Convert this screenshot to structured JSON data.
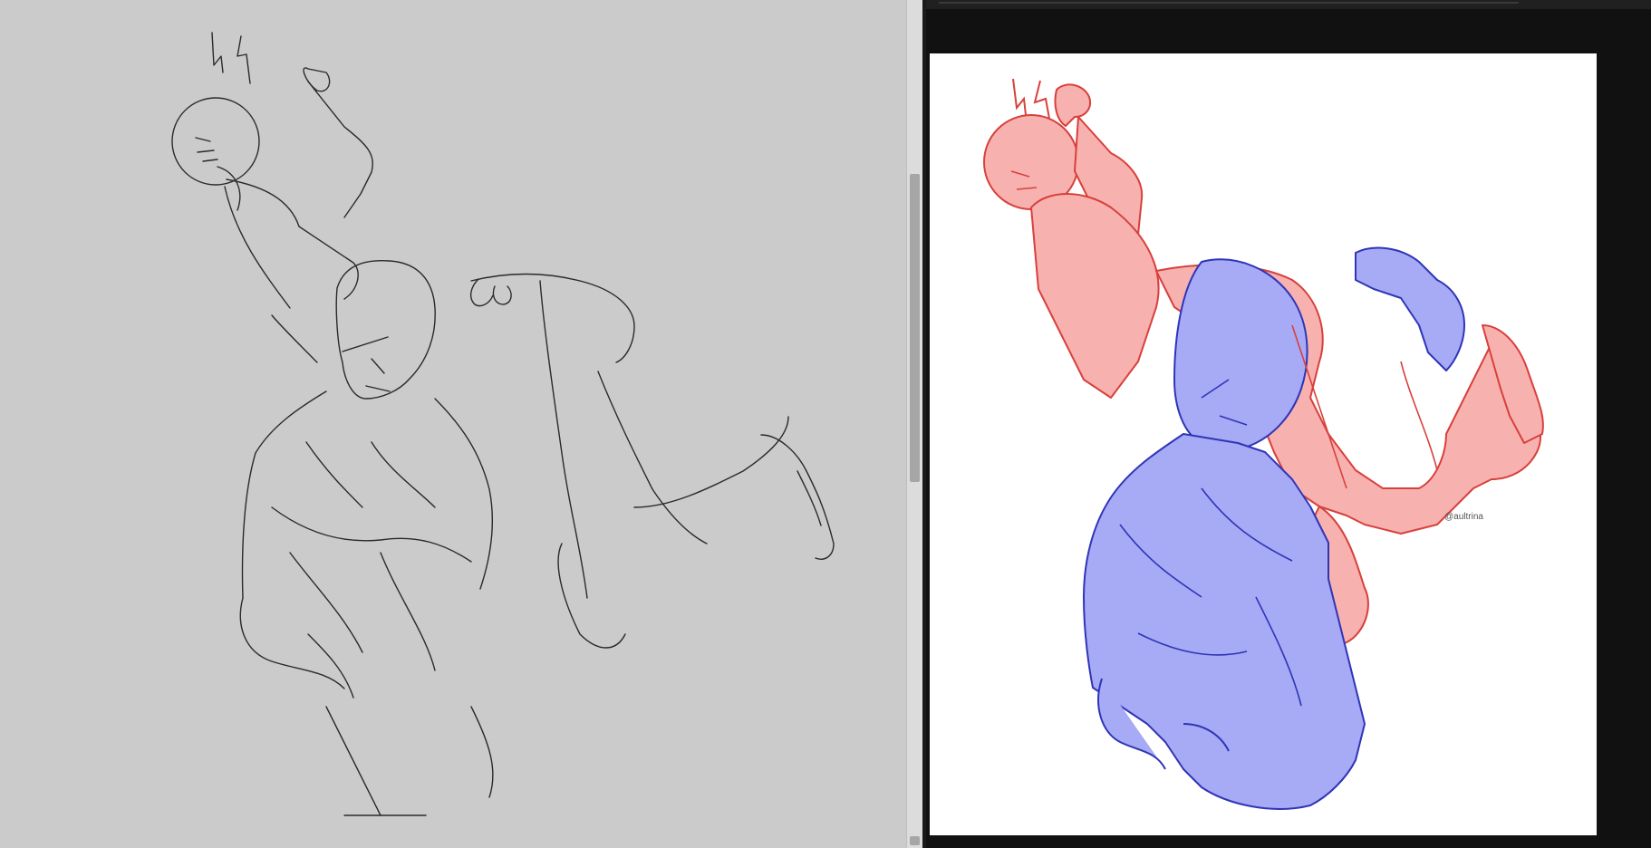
{
  "left_canvas": {
    "background": "#cbcbcb",
    "description_icon": "line-sketch"
  },
  "reference": {
    "background": "#ffffff",
    "colors": {
      "red_figure": "#f7b2b0",
      "red_line": "#d8403c",
      "blue_figure": "#a7aaf4",
      "blue_line": "#2f34b8"
    },
    "signature": "@aultrina"
  }
}
